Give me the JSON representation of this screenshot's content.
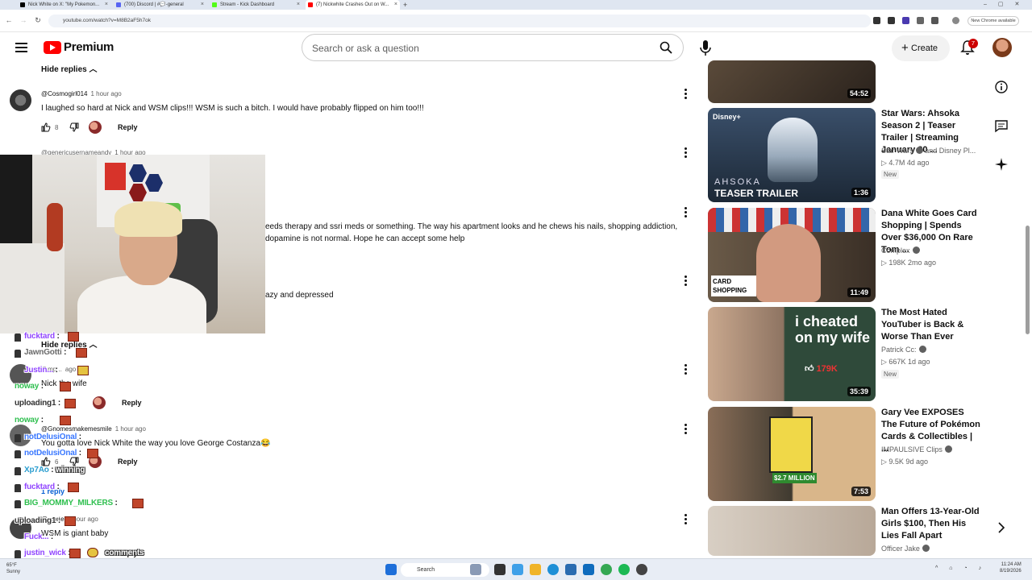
{
  "browser": {
    "tabs": [
      {
        "label": "Nick White on X: \"My Pokemon..."
      },
      {
        "label": "(700) Discord | #💬-general"
      },
      {
        "label": "Stream - Kick Dashboard"
      },
      {
        "label": "(7) Nickwhite Crashes Out on W..."
      }
    ],
    "url": "youtube.com/watch?v=M8B2aF5h7ok",
    "new_chrome": "New Chrome available"
  },
  "header": {
    "logo_text": "Premium",
    "search_placeholder": "Search or ask a question",
    "create_label": "Create",
    "notification_count": "7"
  },
  "comments": {
    "hide_replies_1": "Hide replies",
    "c1": {
      "user": "@Cosmogirl014",
      "time": "1 hour ago",
      "text": "I laughed so hard at Nick and WSM clips!!! WSM is such a bitch. I would have probably flipped on him too!!!",
      "likes": "8",
      "reply": "Reply"
    },
    "c2": {
      "user": "@genericusernameandy",
      "time": "1 hour ago"
    },
    "c3": {
      "line1": "eeds therapy and ssri meds or something. The way his apartment looks and he chews his nails, shopping addiction,",
      "line2": "dopamine is not normal. Hope he can accept some help"
    },
    "c4": {
      "text": "azy and depressed"
    },
    "hide_replies_2": "Hide replies",
    "c5": {
      "user": "@mp...",
      "time": "ago",
      "text": "Nick the wife",
      "reply": "Reply"
    },
    "c6": {
      "user": "@Gnomesmakemesmile",
      "time": "1 hour ago",
      "text": "You gotta love Nick White the way you love George Costanza😂",
      "likes": "6",
      "reply": "Reply"
    },
    "c6_replies": "1 reply",
    "c7": {
      "user": "@...orte",
      "time": "1 hour ago",
      "text": "WSM is giant baby",
      "reply": "Reply"
    }
  },
  "chat": [
    {
      "user": "fucktard",
      "color": "#9146ff",
      "msg": ""
    },
    {
      "user": "JawnGotti",
      "color": "#6a6a6a",
      "msg": ""
    },
    {
      "user": "Justin...",
      "color": "#9146ff",
      "msg": ""
    },
    {
      "user": "noway",
      "color": "#2fbf4f",
      "msg": ""
    },
    {
      "user": "uploading1",
      "color": "#333333",
      "msg": ""
    },
    {
      "user": "noway",
      "color": "#2fbf4f",
      "msg": ""
    },
    {
      "user": "notDelusiOnal",
      "color": "#3a78ff",
      "msg": ""
    },
    {
      "user": "notDelusiOnal",
      "color": "#3a78ff",
      "msg": ""
    },
    {
      "user": "Xp7Ao",
      "color": "#2a9dcf",
      "msg": "winning"
    },
    {
      "user": "fucktard",
      "color": "#9146ff",
      "msg": ""
    },
    {
      "user": "BIG_MOMMY_MILKERS",
      "color": "#2fbf4f",
      "msg": ""
    },
    {
      "user": "uploading1",
      "color": "#333333",
      "msg": ""
    },
    {
      "user": "Fuck...",
      "color": "#9146ff",
      "msg": ""
    },
    {
      "user": "justin_wick",
      "color": "#9146ff",
      "msg": "comments"
    }
  ],
  "sidebar": {
    "videos": [
      {
        "duration": "54:52",
        "title": "",
        "channel": "",
        "meta": ""
      },
      {
        "duration": "1:36",
        "title": "Star Wars: Ahsoka Season 2 | Teaser Trailer | Streaming January 20 ...",
        "channel": "Star Wars",
        "channel_extra": "and Disney Pl...",
        "meta": "4.7M  4d ago",
        "badge": "New",
        "thumb_text": "TEASER TRAILER",
        "thumb_logo": "AHSOKA"
      },
      {
        "duration": "11:49",
        "title": "Dana White Goes Card Shopping | Spends Over $36,000 On Rare Tom ...",
        "channel": "Complex",
        "meta": "198K  2mo ago",
        "thumb_text": "CARD SHOPPING"
      },
      {
        "duration": "35:39",
        "title": "The Most Hated YouTuber is Back & Worse Than Ever",
        "channel": "Patrick Cc:",
        "meta": "667K  1d ago",
        "badge": "New",
        "thumb_text": "i cheated on my wife",
        "thumb_likes": "179K"
      },
      {
        "duration": "7:53",
        "title": "Gary Vee EXPOSES The Future of Pokémon Cards & Collectibles | ...",
        "channel": "IMPAULSIVE Clips",
        "meta": "9.5K  9d ago",
        "thumb_text": "$2.7 MILLION"
      },
      {
        "duration": "",
        "title": "Man Offers 13-Year-Old Girls $100, Then His Lies Fall Apart",
        "channel": "Officer Jake",
        "meta": ""
      }
    ]
  },
  "taskbar": {
    "search": "Search",
    "weather": "65°F",
    "weather_desc": "Sunny",
    "time": "11:24 AM",
    "date": "8/19/2026"
  },
  "colors": {
    "yt_red": "#ff0000",
    "accent": "#065fd4"
  }
}
